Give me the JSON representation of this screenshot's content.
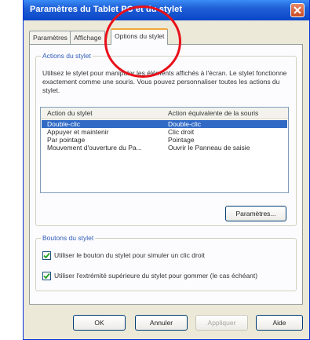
{
  "window": {
    "title": "Paramètres du Tablet PC et du stylet"
  },
  "tabs": [
    {
      "label": "Paramètres"
    },
    {
      "label": "Affichage"
    },
    {
      "label": "Options du stylet"
    }
  ],
  "pen_actions": {
    "group_title": "Actions du stylet",
    "description": "Utilisez le stylet pour manipuler les éléments affichés à l'écran. Le stylet fonctionne exactement comme une souris. Vous pouvez personnaliser toutes les actions du stylet.",
    "columns": [
      "Action du stylet",
      "Action équivalente de la souris"
    ],
    "rows": [
      {
        "action": "Double-clic",
        "equivalent": "Double-clic",
        "selected": true
      },
      {
        "action": "Appuyer et maintenir",
        "equivalent": "Clic droit",
        "selected": false
      },
      {
        "action": "Par pointage",
        "equivalent": "Pointage",
        "selected": false
      },
      {
        "action": "Mouvement d'ouverture du Pa...",
        "equivalent": "Ouvrir le Panneau de saisie",
        "selected": false
      }
    ],
    "settings_button": "Paramètres..."
  },
  "pen_buttons": {
    "group_title": "Boutons du stylet",
    "options": [
      {
        "label": "Utiliser le bouton du stylet pour simuler un clic droit",
        "checked": true
      },
      {
        "label": "Utiliser l'extrémité supérieure du stylet pour gommer (le cas échéant)",
        "checked": true
      }
    ]
  },
  "footer": {
    "ok": "OK",
    "cancel": "Annuler",
    "apply": "Appliquer",
    "help": "Aide"
  }
}
